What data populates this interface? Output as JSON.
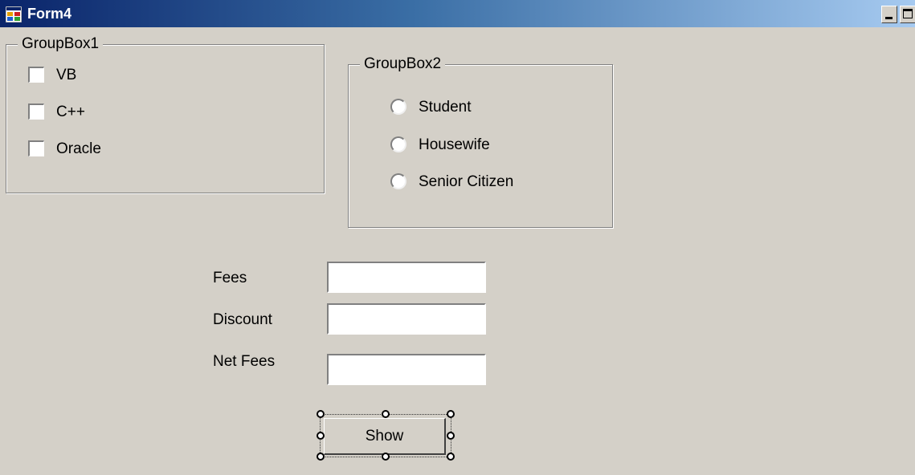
{
  "window": {
    "title": "Form4",
    "icon": "form-app-icon",
    "controls": [
      "minimize-icon",
      "maximize-icon"
    ]
  },
  "groupbox1": {
    "title": "GroupBox1",
    "checkboxes": [
      {
        "label": "VB",
        "checked": false
      },
      {
        "label": "C++",
        "checked": false
      },
      {
        "label": "Oracle",
        "checked": false
      }
    ]
  },
  "groupbox2": {
    "title": "GroupBox2",
    "radios": [
      {
        "label": "Student",
        "selected": false
      },
      {
        "label": "Housewife",
        "selected": false
      },
      {
        "label": "Senior Citizen",
        "selected": false
      }
    ]
  },
  "fields": {
    "fees": {
      "label": "Fees",
      "value": ""
    },
    "discount": {
      "label": "Discount",
      "value": ""
    },
    "net_fees": {
      "label": "Net Fees",
      "value": ""
    }
  },
  "show_button": {
    "label": "Show",
    "selected_in_designer": true
  },
  "colors": {
    "form_background": "#d4d0c8",
    "titlebar_start": "#0a246a",
    "titlebar_end": "#a6caf0",
    "title_text": "#ffffff"
  }
}
